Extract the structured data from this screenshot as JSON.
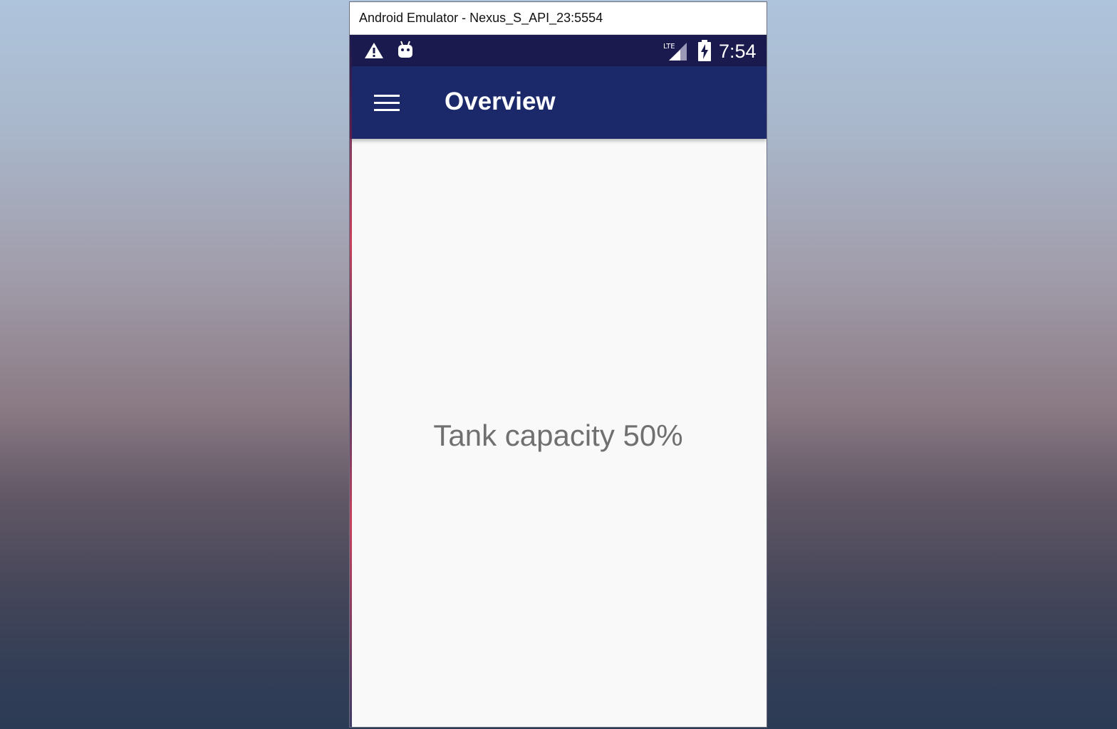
{
  "window": {
    "title": "Android Emulator - Nexus_S_API_23:5554"
  },
  "status_bar": {
    "time": "7:54",
    "network_label": "LTE",
    "icons": [
      "warning-icon",
      "android-icon",
      "signal-icon",
      "battery-charging-icon"
    ]
  },
  "app_bar": {
    "title": "Overview",
    "menu_icon": "hamburger-menu-icon"
  },
  "content": {
    "capacity_text": "Tank capacity 50%"
  },
  "colors": {
    "status_bar": "#1a1a4e",
    "app_bar": "#1b286a",
    "content_background": "#f9f9f9",
    "content_text": "#707070"
  }
}
